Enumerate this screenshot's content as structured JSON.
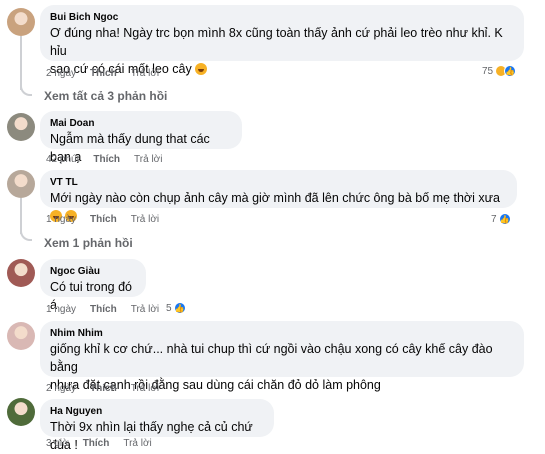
{
  "actions": {
    "like": "Thích",
    "reply": "Trả lời"
  },
  "comments": [
    {
      "name": "Bui Bich Ngoc",
      "lines": [
        "Ơ đúng nha! Ngày trc bọn mình 8x cũng toàn thấy ảnh cứ phải leo trèo như khỉ. K hỉu",
        "sao cứ có cái mốt leo cây"
      ],
      "time": "2 ngày",
      "reaction_count": "75",
      "avatar_color": "#c9a27e"
    },
    {
      "name": "Mai Doan",
      "lines": [
        "Ngẫm mà thấy dung that các bạn ạ"
      ],
      "time": "42 phút",
      "reaction_count": "",
      "avatar_color": "#8c8a7e"
    },
    {
      "name": "VT TL",
      "lines": [
        "Mới ngày nào còn chụp ảnh cây mà giờ mình đã lên chức ông bà bố mẹ thời xưa"
      ],
      "time": "1 ngày",
      "reaction_count": "7",
      "avatar_color": "#b7a89a"
    },
    {
      "name": "Ngoc Giàu",
      "lines": [
        "Có tui trong đó á"
      ],
      "time": "1 ngày",
      "reaction_count": "5",
      "avatar_color": "#a05a55"
    },
    {
      "name": "Nhim Nhim",
      "lines": [
        "giống khỉ k cơ chứ... nhà tui chup thì cứ ngồi vào chậu xong có cây khế cây đào bằng",
        "nhựa đặt cạnh rồi đằng sau dùng cái chăn đỏ dỏ làm phông"
      ],
      "time": "2 ngày",
      "reaction_count": "",
      "avatar_color": "#d9b8b4"
    },
    {
      "name": "Ha Nguyen",
      "lines": [
        "Thời 9x nhìn lại thấy nghẹ cả củ chứ đùa !"
      ],
      "time": "3 giờ",
      "reaction_count": "",
      "avatar_color": "#4f6b3a"
    }
  ],
  "see_replies": [
    "Xem tất cả 3 phản hồi",
    "Xem 1 phản hồi"
  ]
}
